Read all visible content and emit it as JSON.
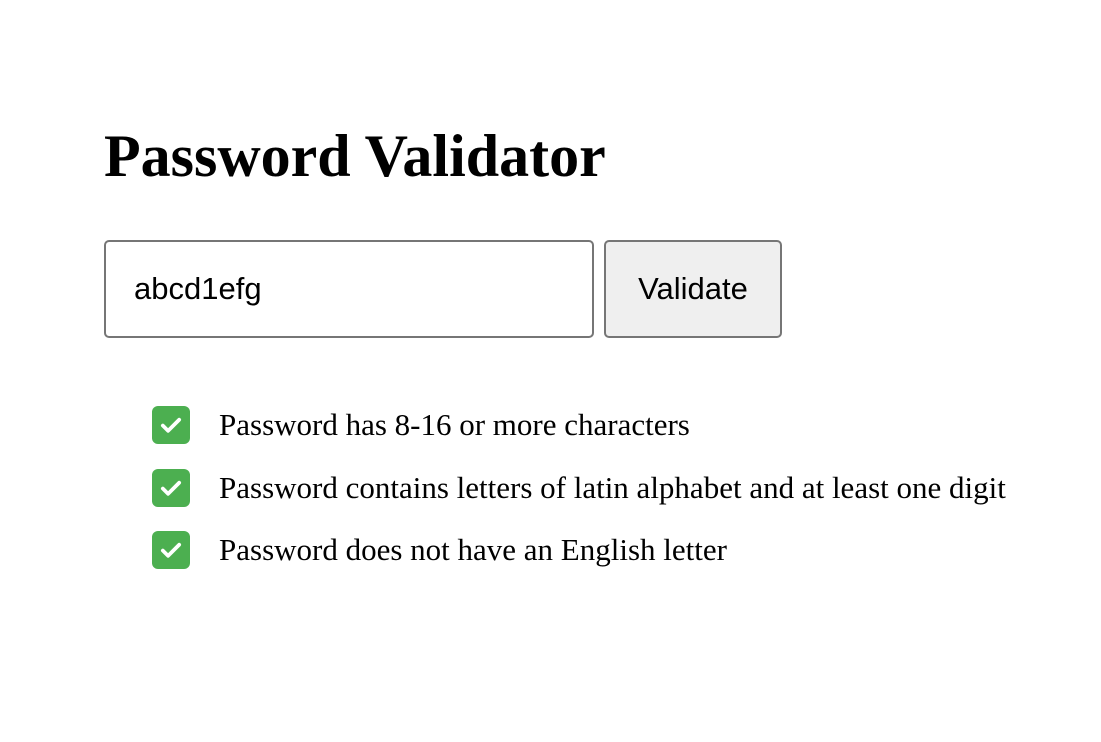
{
  "page": {
    "title": "Password Validator"
  },
  "form": {
    "password_value": "abcd1efg",
    "validate_label": "Validate"
  },
  "rules": [
    {
      "icon": "checkmark-icon",
      "passed": true,
      "text": "Password has 8-16 or more characters"
    },
    {
      "icon": "checkmark-icon",
      "passed": true,
      "text": "Password contains letters of latin alphabet and at least one digit"
    },
    {
      "icon": "checkmark-icon",
      "passed": true,
      "text": "Password does not have an English letter"
    }
  ],
  "colors": {
    "check_background": "#4caf50",
    "button_background": "#efefef",
    "border": "#767676"
  }
}
